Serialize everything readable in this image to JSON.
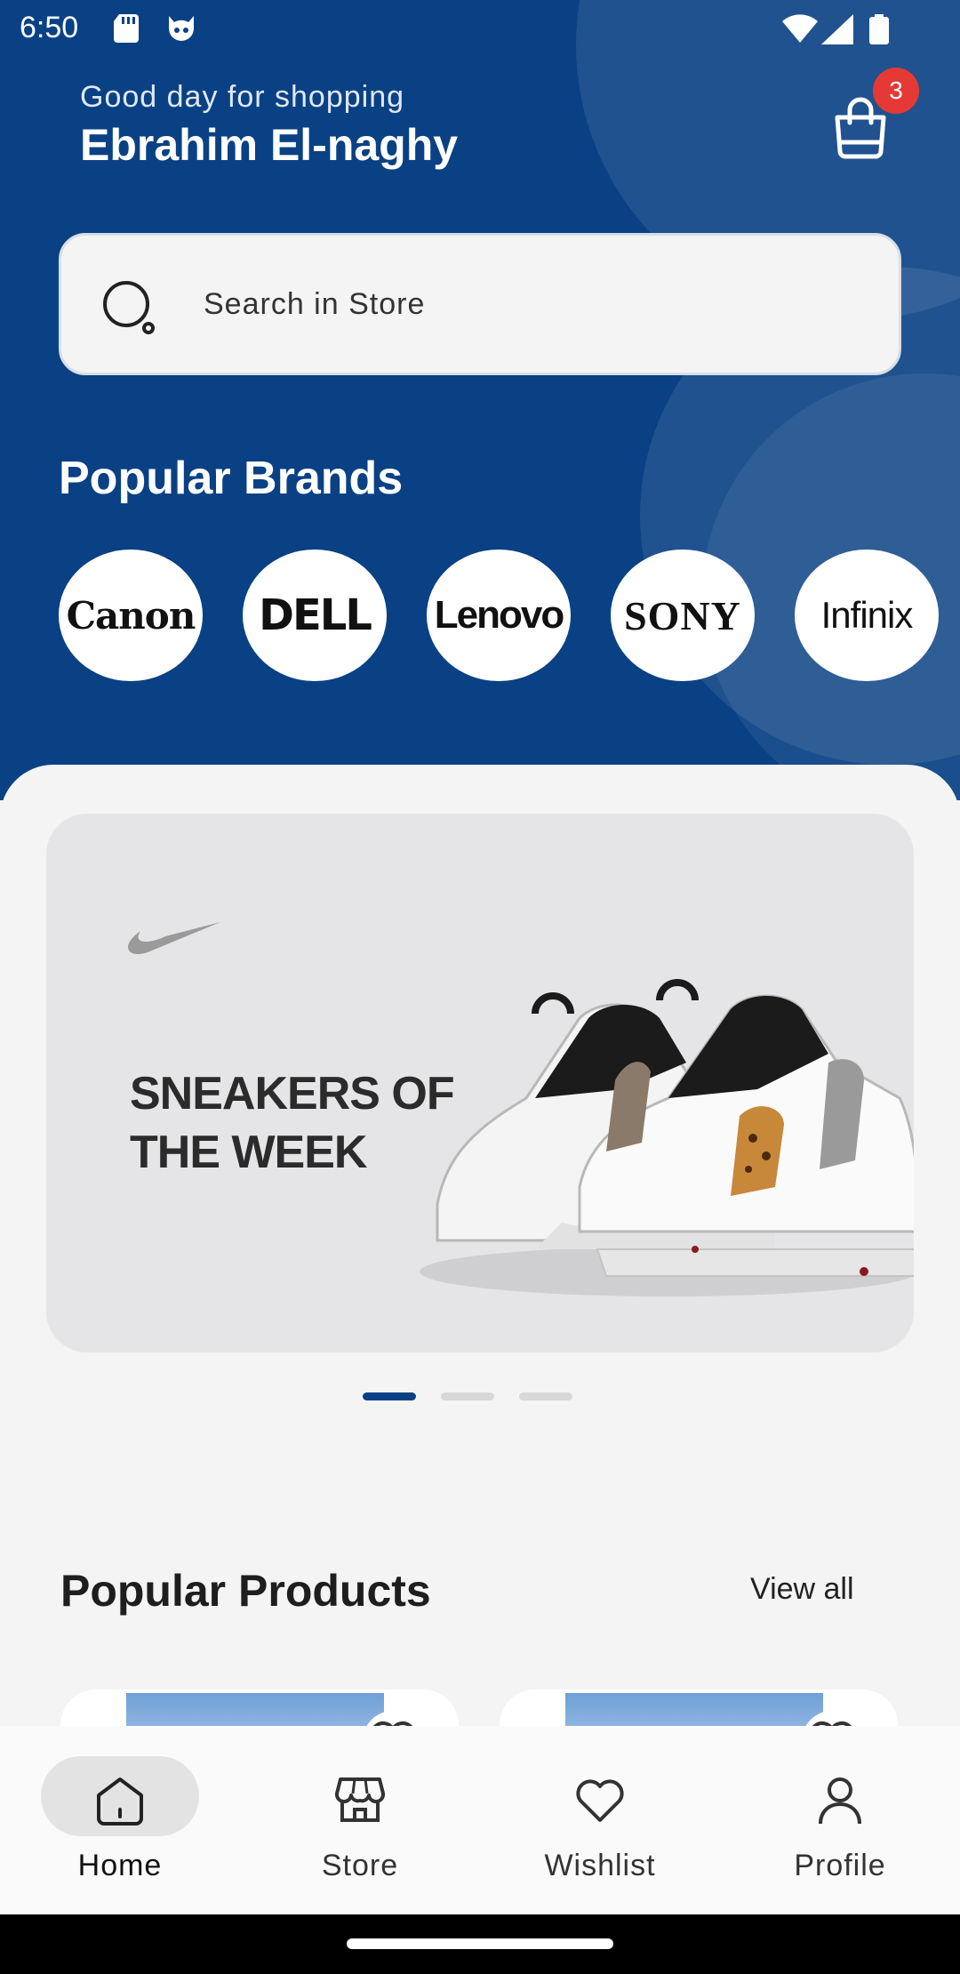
{
  "status_bar": {
    "time": "6:50"
  },
  "header": {
    "greeting": "Good day for shopping",
    "username": "Ebrahim El-naghy",
    "cart_count": "3"
  },
  "search": {
    "placeholder": "Search in Store"
  },
  "brands": {
    "title": "Popular Brands",
    "items": [
      "Canon",
      "DELL",
      "Lenovo",
      "SONY",
      "Infinix"
    ]
  },
  "banner": {
    "title": "SNEAKERS OF THE WEEK",
    "slides": 3,
    "active_slide": 1
  },
  "products": {
    "title": "Popular Products",
    "view_all": "View all"
  },
  "nav": {
    "items": [
      {
        "label": "Home",
        "icon": "home-icon",
        "active": true
      },
      {
        "label": "Store",
        "icon": "store-icon",
        "active": false
      },
      {
        "label": "Wishlist",
        "icon": "heart-icon",
        "active": false
      },
      {
        "label": "Profile",
        "icon": "user-icon",
        "active": false
      }
    ]
  },
  "colors": {
    "primary": "#0a4184",
    "badge": "#e53935",
    "background": "#f4f4f4"
  }
}
